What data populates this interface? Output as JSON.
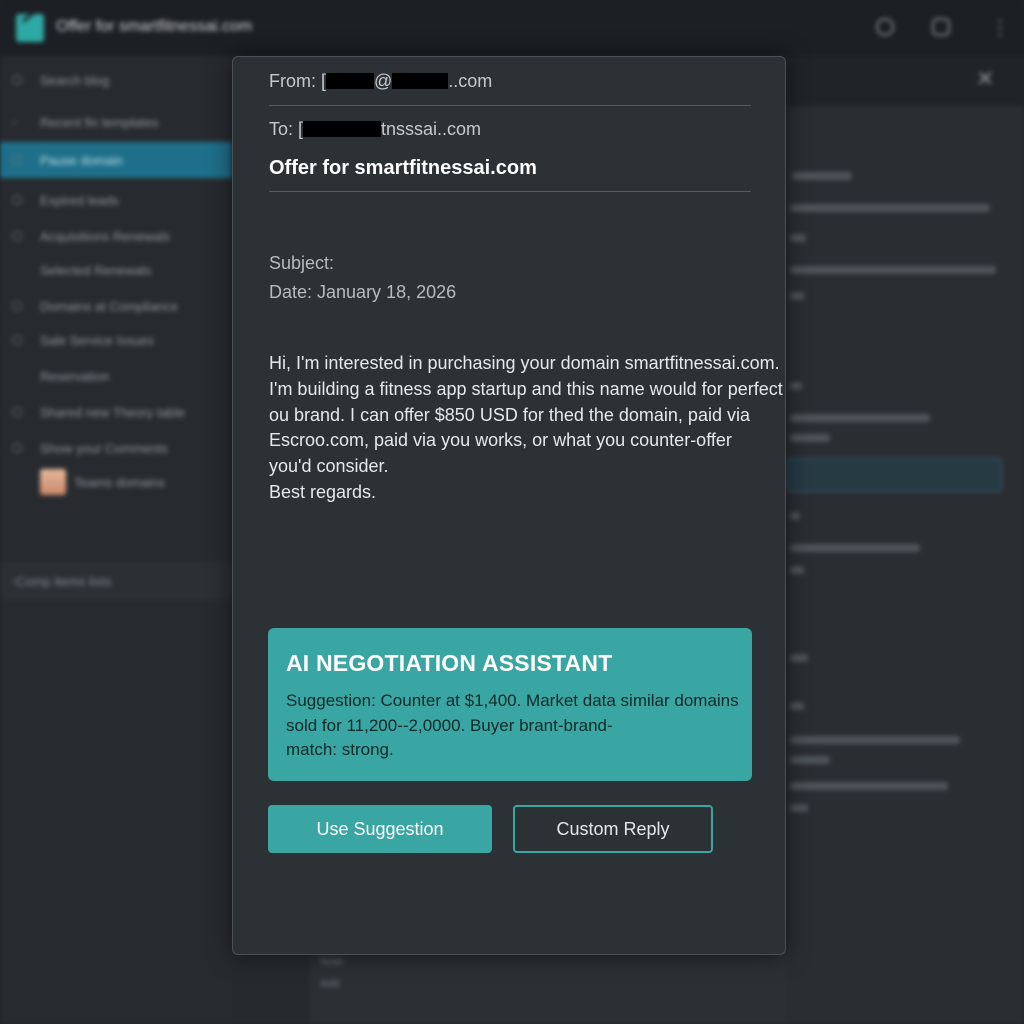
{
  "window": {
    "title": "Offer for smartfitnessai.com",
    "icons": [
      "app-logo-icon",
      "settings-icon",
      "window-icon",
      "more-vertical-icon"
    ]
  },
  "sidebar": {
    "items": [
      {
        "label": "Search blog",
        "icon": "circle-icon"
      },
      {
        "label": "Recent fin templates",
        "icon": "chevron-icon"
      },
      {
        "label": "Pause domain",
        "icon": "circle-icon",
        "active": true
      },
      {
        "label": "Expired leads",
        "icon": "circle-icon"
      },
      {
        "label": "Acquisitions Renewals",
        "icon": "circle-icon"
      },
      {
        "label": "Selected Renewals",
        "icon": ""
      },
      {
        "label": "Domains at Compliance",
        "icon": "circle-icon"
      },
      {
        "label": "Sale Service Issues",
        "icon": "circle-icon"
      },
      {
        "label": "Reservation",
        "icon": ""
      },
      {
        "label": "Shared new Theory table",
        "icon": "circle-icon"
      },
      {
        "label": "Show your Comments",
        "icon": "circle-icon"
      },
      {
        "label": "Teams domains",
        "icon": "avatar"
      }
    ],
    "footer": "Comp items lists"
  },
  "email": {
    "from_prefix": "From: [",
    "from_mid": "@",
    "from_suffix": "..com",
    "to_prefix": "To: [",
    "to_suffix": "tnsssai..com",
    "subject_line": "Offer for smartfitnessai.com",
    "subject_label": "Subject:",
    "date_label": "Date: January 18, 2026",
    "body_lines": [
      "Hi, I'm interested in purchasing your domain smartfitnessai.com.",
      "I'm building a fitness app startup and this name would for perfect",
      "ou brand. I can offer $850 USD for thed  the domain, paid via",
      "Escroo.com, paid via you works, or what you counter-offer",
      "you'd consider.",
      "Best regards."
    ]
  },
  "assistant": {
    "title": "AI NEGOTIATION ASSISTANT",
    "lines": [
      "Suggestion: Counter at $1,400. Market data similar domains",
      "sold for 11,200--2,0000. Buyer brant-brand-",
      "match: strong."
    ],
    "accent_color": "#3aa6a4"
  },
  "actions": {
    "use_suggestion": "Use Suggestion",
    "custom_reply": "Custom Reply"
  },
  "right_panel": {
    "close_icon": "close-icon"
  },
  "lower": {
    "line1": "Note",
    "line2": "Add"
  }
}
